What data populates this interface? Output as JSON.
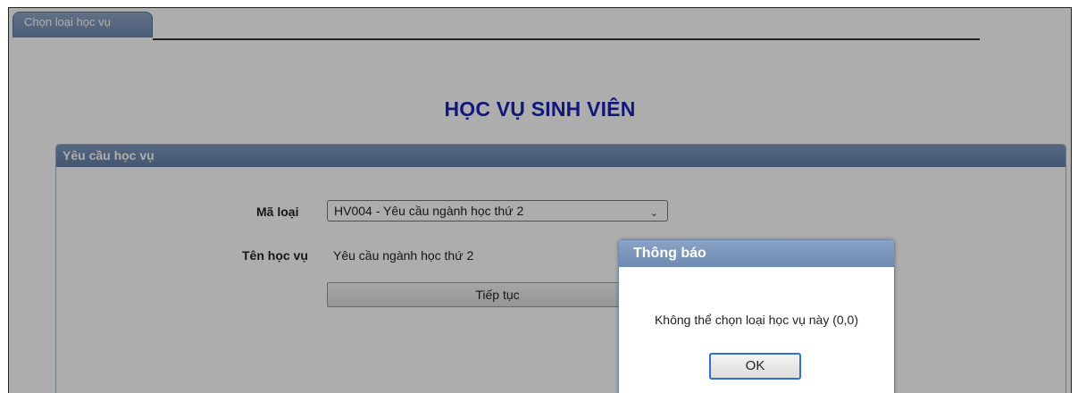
{
  "tabs": [
    {
      "label": "Chọn loại học vụ"
    }
  ],
  "page": {
    "title": "HỌC VỤ SINH VIÊN"
  },
  "panel": {
    "header": "Yêu cầu học vụ",
    "ma_loai_label": "Mã loại",
    "ma_loai_value": "HV004 - Yêu cầu ngành học thứ 2",
    "ten_hoc_vu_label": "Tên học vụ",
    "ten_hoc_vu_value": "Yêu cầu ngành học thứ 2",
    "continue_label": "Tiếp tục"
  },
  "dialog": {
    "title": "Thông báo",
    "message": "Không thể chọn loại học vụ này (0,0)",
    "ok_label": "OK"
  },
  "colors": {
    "accent": "#6f8ab0",
    "title": "#1b22b5",
    "focus": "#2f6fd8"
  }
}
